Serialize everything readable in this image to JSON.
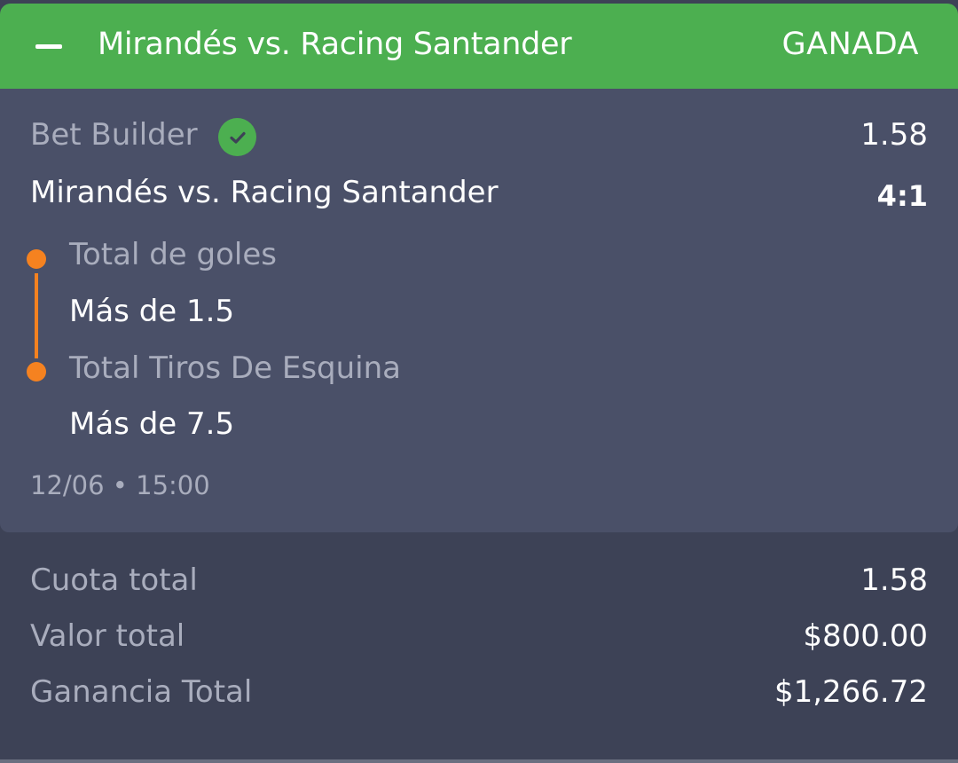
{
  "header": {
    "title": "Mirandés vs. Racing Santander",
    "status": "GANADA",
    "status_color": "#4caf50"
  },
  "selection": {
    "type_label": "Bet Builder",
    "check_icon": "check-circle-icon",
    "odds": "1.58",
    "match": "Mirandés vs. Racing Santander",
    "score": "4:1",
    "markets": [
      {
        "market": "Total de goles",
        "selection": "Más de 1.5"
      },
      {
        "market": "Total Tiros De Esquina",
        "selection": "Más de 7.5"
      }
    ],
    "datetime": "12/06 • 15:00"
  },
  "summary": {
    "total_odds_label": "Cuota total",
    "total_odds_value": "1.58",
    "total_stake_label": "Valor total",
    "total_stake_value": "$800.00",
    "total_win_label": "Ganancia Total",
    "total_win_value": "$1,266.72"
  },
  "colors": {
    "accent_orange": "#f58220",
    "card_bg": "#3d4256",
    "selection_bg": "#4a5068"
  }
}
